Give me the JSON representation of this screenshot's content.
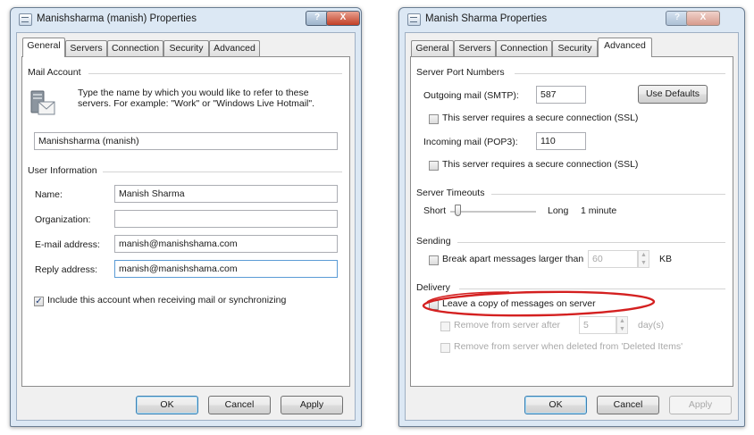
{
  "left_dialog": {
    "title": "Manishsharma (manish) Properties",
    "help_glyph": "?",
    "close_glyph": "X",
    "tabs": [
      {
        "label": "General",
        "active": true
      },
      {
        "label": "Servers",
        "active": false
      },
      {
        "label": "Connection",
        "active": false
      },
      {
        "label": "Security",
        "active": false
      },
      {
        "label": "Advanced",
        "active": false
      }
    ],
    "mail_account": {
      "group_title": "Mail Account",
      "description": "Type the name by which you would like to refer to these servers.  For example: \"Work\" or \"Windows Live Hotmail\".",
      "account_name": "Manishsharma (manish)",
      "icon": "mail-server-icon"
    },
    "user_information": {
      "group_title": "User Information",
      "name_label": "Name:",
      "name_value": "Manish Sharma",
      "organization_label": "Organization:",
      "organization_value": "",
      "email_label": "E-mail address:",
      "email_value": "manish@manishshama.com",
      "reply_label": "Reply address:",
      "reply_value": "manish@manishshama.com"
    },
    "include_account": {
      "label": "Include this account when receiving mail or synchronizing",
      "checked": true
    },
    "buttons": {
      "ok": "OK",
      "cancel": "Cancel",
      "apply": "Apply"
    }
  },
  "right_dialog": {
    "title": "Manish Sharma Properties",
    "help_glyph": "?",
    "close_glyph": "X",
    "tabs": [
      {
        "label": "General",
        "active": false
      },
      {
        "label": "Servers",
        "active": false
      },
      {
        "label": "Connection",
        "active": false
      },
      {
        "label": "Security",
        "active": false
      },
      {
        "label": "Advanced",
        "active": true
      }
    ],
    "server_ports": {
      "group_title": "Server Port Numbers",
      "outgoing_label": "Outgoing mail (SMTP):",
      "outgoing_value": "587",
      "use_defaults": "Use Defaults",
      "smtp_ssl_label": "This server requires a secure connection (SSL)",
      "smtp_ssl_checked": false,
      "incoming_label": "Incoming mail (POP3):",
      "incoming_value": "110",
      "pop3_ssl_label": "This server requires a secure connection (SSL)",
      "pop3_ssl_checked": false
    },
    "server_timeouts": {
      "group_title": "Server Timeouts",
      "short_label": "Short",
      "long_label": "Long",
      "value_label": "1 minute",
      "slider_level": 0.08
    },
    "sending": {
      "group_title": "Sending",
      "break_apart_label": "Break apart messages larger than",
      "break_apart_checked": false,
      "break_apart_value": "60",
      "unit": "KB"
    },
    "delivery": {
      "group_title": "Delivery",
      "leave_copy_label": "Leave a copy of messages on server",
      "leave_copy_checked": false,
      "remove_after_label": "Remove from server after",
      "remove_after_value": "5",
      "days_label": "day(s)",
      "remove_deleted_label": "Remove from server when deleted from 'Deleted Items'"
    },
    "buttons": {
      "ok": "OK",
      "cancel": "Cancel",
      "apply": "Apply"
    }
  },
  "annotation": {
    "color": "#d42020"
  }
}
